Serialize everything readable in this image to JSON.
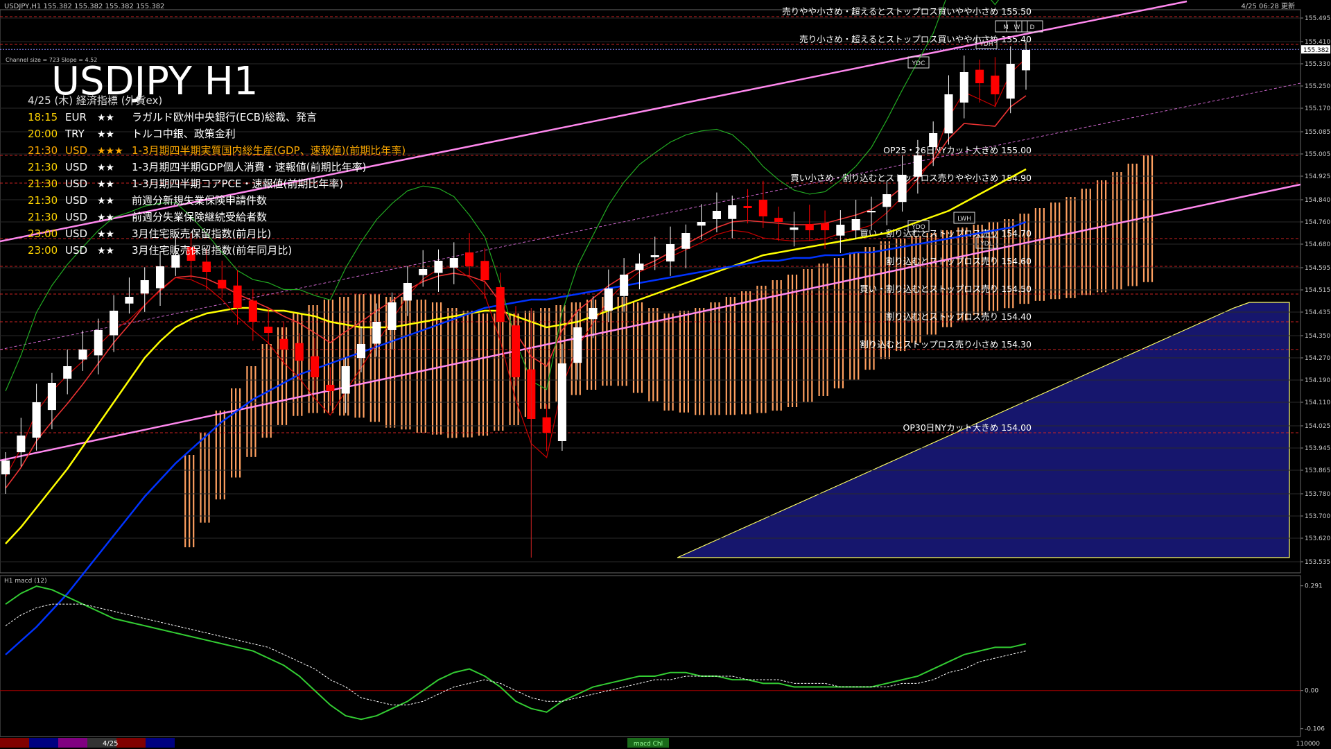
{
  "window": {
    "header": "USDJPY,H1  155.382 155.382 155.382 155.382",
    "timestamp": "4/25 06:28 更新"
  },
  "chart_title": "USDJPY H1",
  "channel_info": "Channel size = 723 Slope = 4.52",
  "calendar": {
    "heading": "4/25 (木) 経済指標 (外貨ex)",
    "events": [
      {
        "time": "18:15",
        "cur": "EUR",
        "stars": "★★",
        "title": "ラガルド欧州中央銀行(ECB)総裁、発言",
        "highlight": false
      },
      {
        "time": "20:00",
        "cur": "TRY",
        "stars": "★★",
        "title": "トルコ中銀、政策金利",
        "highlight": false
      },
      {
        "time": "21:30",
        "cur": "USD",
        "stars": "★★★",
        "title": "1-3月期四半期実質国内総生産(GDP、速報値)(前期比年率)",
        "highlight": true
      },
      {
        "time": "21:30",
        "cur": "USD",
        "stars": "★★",
        "title": "1-3月期四半期GDP個人消費・速報値(前期比年率)",
        "highlight": false
      },
      {
        "time": "21:30",
        "cur": "USD",
        "stars": "★★",
        "title": "1-3月期四半期コアPCE・速報値(前期比年率)",
        "highlight": false
      },
      {
        "time": "21:30",
        "cur": "USD",
        "stars": "★★",
        "title": "前週分新規失業保険申請件数",
        "highlight": false
      },
      {
        "time": "21:30",
        "cur": "USD",
        "stars": "★★",
        "title": "前週分失業保険継続受給者数",
        "highlight": false
      },
      {
        "time": "23:00",
        "cur": "USD",
        "stars": "★★",
        "title": "3月住宅販売保留指数(前月比)",
        "highlight": false
      },
      {
        "time": "23:00",
        "cur": "USD",
        "stars": "★★",
        "title": "3月住宅販売保留指数(前年同月比)",
        "highlight": false
      }
    ]
  },
  "chart_data": {
    "type": "line",
    "symbol": "USDJPY",
    "timeframe": "H1",
    "price_axis": {
      "ticks": [
        "155.495",
        "155.410",
        "155.330",
        "155.250",
        "155.170",
        "155.085",
        "155.005",
        "154.925",
        "154.840",
        "154.760",
        "154.680",
        "154.595",
        "154.515",
        "154.435",
        "154.350",
        "154.270",
        "154.190",
        "154.110",
        "154.025",
        "153.945",
        "153.865",
        "153.780",
        "153.700",
        "153.620",
        "153.535"
      ],
      "current": "155.382",
      "ylim": [
        153.5,
        155.52
      ]
    },
    "order_levels": [
      {
        "label": "売りやや小さめ・超えるとストップロス買いやや小さめ 155.50",
        "price": 155.5
      },
      {
        "label": "売り小さめ・超えるとストップロス買いやや小さめ 155.40",
        "price": 155.4
      },
      {
        "label": "OP25・26日NYカット大きめ 155.00",
        "price": 155.0
      },
      {
        "label": "買い小さめ・割り込むとストップロス売りやや小さめ 154.90",
        "price": 154.9
      },
      {
        "label": "買い・割り込むとストップロス売り 154.70",
        "price": 154.7
      },
      {
        "label": "割り込むとストップロス売り 154.60",
        "price": 154.6
      },
      {
        "label": "買い・割り込むとストップロス売り 154.50",
        "price": 154.5
      },
      {
        "label": "割り込むとストップロス売り 154.40",
        "price": 154.4
      },
      {
        "label": "割り込むとストップロス売り小さめ 154.30",
        "price": 154.3
      },
      {
        "label": "OP30日NYカット大きめ 154.00",
        "price": 154.0
      }
    ],
    "box_labels": [
      "YDC",
      "YDH",
      "YDO",
      "LWH",
      "YDL",
      "W",
      "D",
      "M"
    ],
    "series": [
      {
        "name": "close",
        "values": [
          153.9,
          153.99,
          154.11,
          154.18,
          154.24,
          154.3,
          154.37,
          154.44,
          154.49,
          154.55,
          154.6,
          154.64,
          154.62,
          154.58,
          154.52,
          154.45,
          154.4,
          154.36,
          154.3,
          154.26,
          154.2,
          154.15,
          154.24,
          154.32,
          154.4,
          154.47,
          154.54,
          154.59,
          154.62,
          154.63,
          154.6,
          154.55,
          154.4,
          154.2,
          154.05,
          154.0,
          154.25,
          154.38,
          154.45,
          154.52,
          154.57,
          154.61,
          154.64,
          154.68,
          154.72,
          154.76,
          154.8,
          154.82,
          154.81,
          154.78,
          154.76,
          154.74,
          154.73,
          154.73,
          154.75,
          154.77,
          154.8,
          154.86,
          154.93,
          155.0,
          155.08,
          155.22,
          155.3,
          155.26,
          155.22,
          155.33,
          155.38
        ]
      },
      {
        "name": "MA-yellow",
        "values": [
          153.6,
          153.66,
          153.73,
          153.8,
          153.87,
          153.95,
          154.03,
          154.11,
          154.19,
          154.27,
          154.33,
          154.38,
          154.41,
          154.43,
          154.44,
          154.45,
          154.45,
          154.44,
          154.44,
          154.43,
          154.42,
          154.4,
          154.39,
          154.38,
          154.38,
          154.38,
          154.39,
          154.4,
          154.41,
          154.42,
          154.43,
          154.44,
          154.44,
          154.42,
          154.4,
          154.38,
          154.39,
          154.4,
          154.42,
          154.44,
          154.46,
          154.48,
          154.5,
          154.52,
          154.54,
          154.56,
          154.58,
          154.6,
          154.62,
          154.64,
          154.65,
          154.66,
          154.67,
          154.68,
          154.69,
          154.7,
          154.71,
          154.72,
          154.74,
          154.76,
          154.78,
          154.8,
          154.83,
          154.86,
          154.89,
          154.92,
          154.95
        ]
      },
      {
        "name": "MA-blue",
        "values": [
          153.2,
          153.25,
          153.3,
          153.36,
          153.42,
          153.49,
          153.56,
          153.63,
          153.7,
          153.77,
          153.83,
          153.89,
          153.94,
          153.99,
          154.04,
          154.08,
          154.12,
          154.15,
          154.18,
          154.21,
          154.23,
          154.25,
          154.27,
          154.29,
          154.31,
          154.33,
          154.35,
          154.37,
          154.39,
          154.41,
          154.43,
          154.45,
          154.46,
          154.47,
          154.48,
          154.48,
          154.49,
          154.5,
          154.51,
          154.52,
          154.53,
          154.54,
          154.55,
          154.56,
          154.57,
          154.58,
          154.59,
          154.6,
          154.61,
          154.62,
          154.62,
          154.63,
          154.63,
          154.64,
          154.64,
          154.65,
          154.65,
          154.66,
          154.67,
          154.68,
          154.69,
          154.7,
          154.71,
          154.72,
          154.73,
          154.74,
          154.76
        ]
      }
    ],
    "macd": {
      "label": "H1  macd (12)",
      "ticks": [
        "0.291",
        "0.00",
        "-0.106"
      ],
      "ylim": [
        -0.12,
        0.3
      ],
      "main": [
        0.24,
        0.27,
        0.29,
        0.28,
        0.26,
        0.24,
        0.22,
        0.2,
        0.19,
        0.18,
        0.17,
        0.16,
        0.15,
        0.14,
        0.13,
        0.12,
        0.11,
        0.09,
        0.07,
        0.04,
        0.0,
        -0.04,
        -0.07,
        -0.08,
        -0.07,
        -0.05,
        -0.03,
        0.0,
        0.03,
        0.05,
        0.06,
        0.04,
        0.01,
        -0.03,
        -0.05,
        -0.06,
        -0.03,
        -0.01,
        0.01,
        0.02,
        0.03,
        0.04,
        0.04,
        0.05,
        0.05,
        0.04,
        0.04,
        0.03,
        0.03,
        0.02,
        0.02,
        0.01,
        0.01,
        0.01,
        0.01,
        0.01,
        0.01,
        0.02,
        0.03,
        0.04,
        0.06,
        0.08,
        0.1,
        0.11,
        0.12,
        0.12,
        0.13
      ],
      "signal": [
        0.18,
        0.21,
        0.23,
        0.24,
        0.24,
        0.24,
        0.23,
        0.22,
        0.21,
        0.2,
        0.19,
        0.18,
        0.17,
        0.16,
        0.15,
        0.14,
        0.13,
        0.12,
        0.1,
        0.08,
        0.06,
        0.03,
        0.01,
        -0.02,
        -0.03,
        -0.04,
        -0.04,
        -0.03,
        -0.01,
        0.01,
        0.02,
        0.03,
        0.02,
        0.0,
        -0.02,
        -0.03,
        -0.03,
        -0.02,
        -0.01,
        0.0,
        0.01,
        0.02,
        0.03,
        0.03,
        0.04,
        0.04,
        0.04,
        0.04,
        0.03,
        0.03,
        0.03,
        0.02,
        0.02,
        0.02,
        0.01,
        0.01,
        0.01,
        0.01,
        0.02,
        0.02,
        0.03,
        0.05,
        0.06,
        0.08,
        0.09,
        0.1,
        0.11
      ]
    },
    "bottom_bar": {
      "date": "4/25",
      "macd_label": "macd Chl",
      "end_value": "110000"
    }
  },
  "colors": {
    "bg": "#000000",
    "grid": "#2a2a2a",
    "bull": "#ffffff",
    "bear": "#ff0000",
    "cloud": "#ffa060",
    "cloud2": "#1a1a80",
    "ma_yellow": "#ffff00",
    "ma_blue": "#0033ff",
    "channel": "#ff88ee",
    "level": "#cc2222",
    "macd_main": "#33cc33",
    "macd_signal": "#ffffff",
    "calendar_highlight": "#ffaa00",
    "calendar_text": "#ffffff",
    "calendar_time": "#ffd400"
  }
}
